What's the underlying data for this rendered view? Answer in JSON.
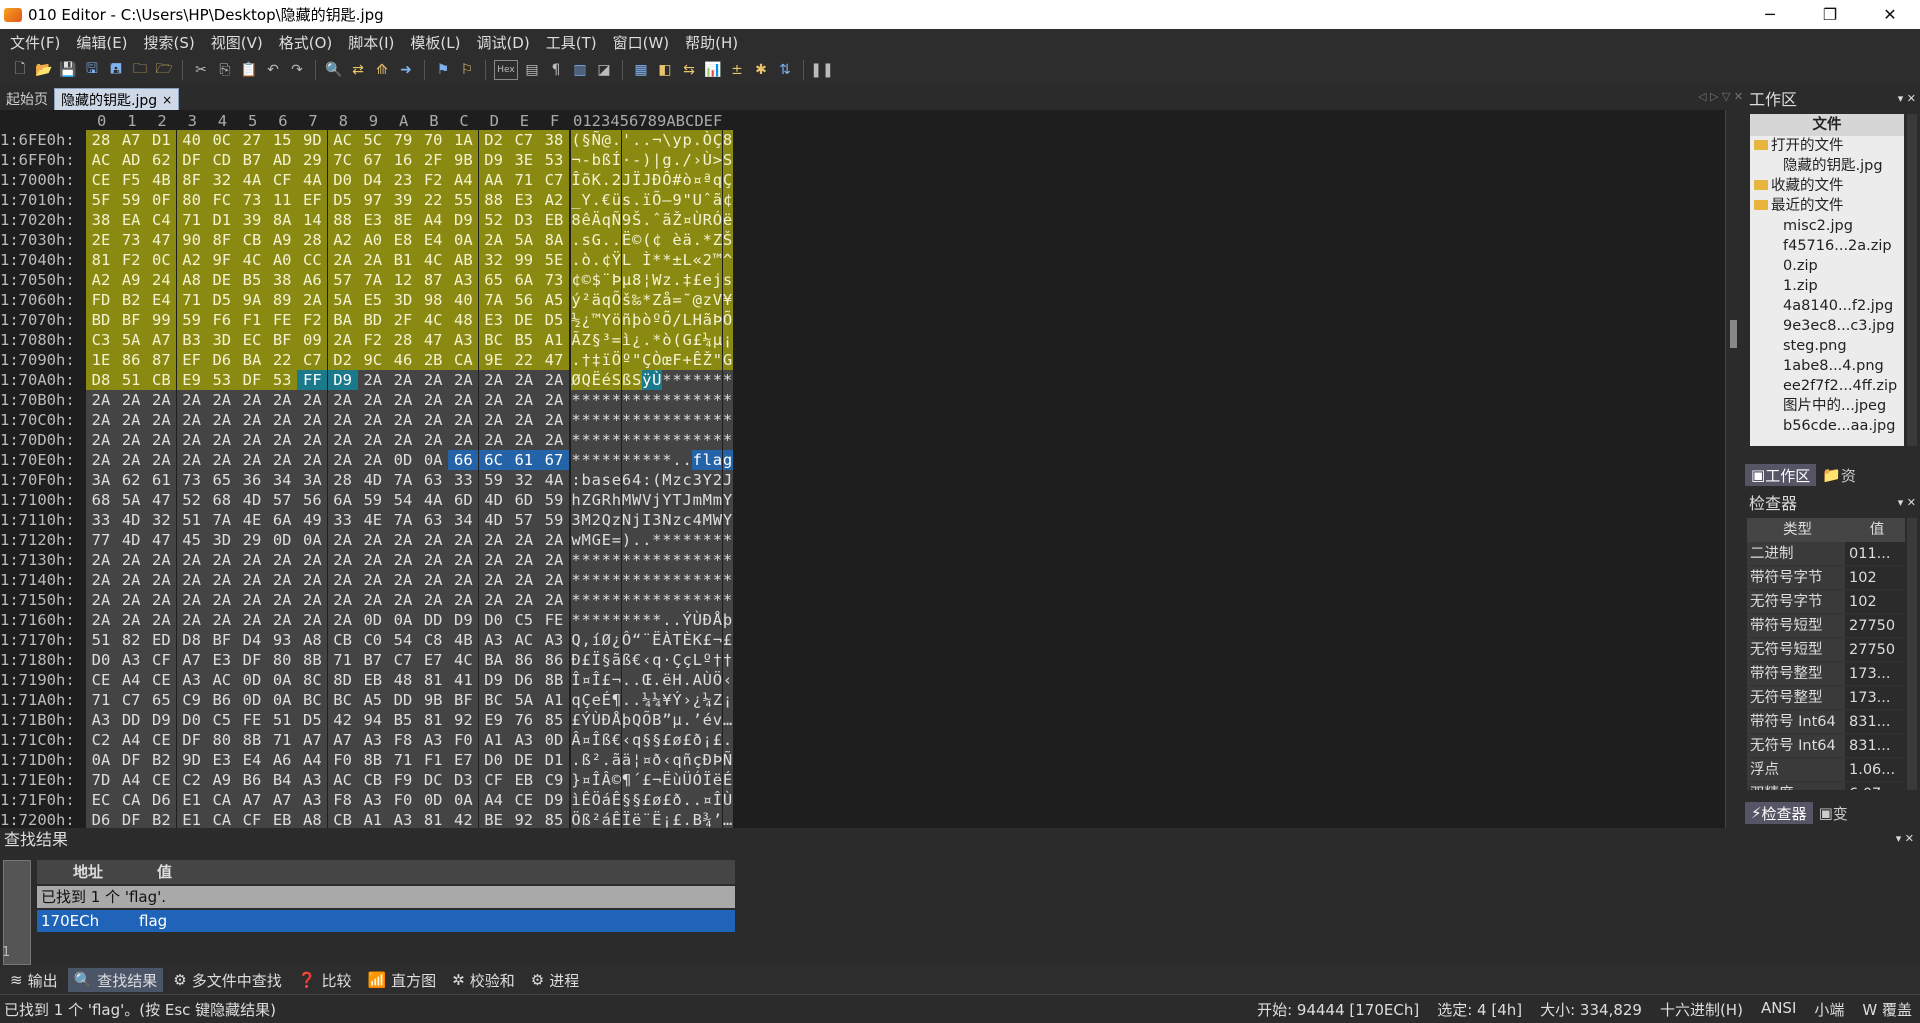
{
  "window": {
    "title": "010 Editor - C:\\Users\\HP\\Desktop\\隐藏的钥匙.jpg",
    "minimize": "─",
    "restore": "❐",
    "close": "✕"
  },
  "menu": [
    "文件(F)",
    "编辑(E)",
    "搜索(S)",
    "视图(V)",
    "格式(O)",
    "脚本(I)",
    "模板(L)",
    "调试(D)",
    "工具(T)",
    "窗口(W)",
    "帮助(H)"
  ],
  "toolbar": {
    "hex_label": "Hex"
  },
  "tabs": [
    {
      "label": "起始页"
    },
    {
      "label": "隐藏的钥匙.jpg",
      "close": "×"
    }
  ],
  "hex": {
    "col_headers": [
      "0",
      "1",
      "2",
      "3",
      "4",
      "5",
      "6",
      "7",
      "8",
      "9",
      "A",
      "B",
      "C",
      "D",
      "E",
      "F"
    ],
    "ascii_header": "0123456789ABCDEF",
    "rows": [
      {
        "addr": "1:6FE0h:",
        "bytes": "28 A7 D1 40 0C 27 15 9D AC 5C 79 70 1A D2 C7 38",
        "ascii": "(§Ñ@.'..¬\\yp.ÒÇ8",
        "hl": "yyyyyyyyyyyyyyyy"
      },
      {
        "addr": "1:6FF0h:",
        "bytes": "AC AD 62 DF CD B7 AD 29 7C 67 16 2F 9B D9 3E 53",
        "ascii": "¬-bßÍ·-)|g./›Ù>S",
        "hl": "yyyyyyyyyyyyyyyy"
      },
      {
        "addr": "1:7000h:",
        "bytes": "CE F5 4B 8F 32 4A CF 4A D0 D4 23 F2 A4 AA 71 C7",
        "ascii": "ÎõK.2JÏJÐÔ#ò¤ªqÇ",
        "hl": "yyyyyyyyyyyyyyyy"
      },
      {
        "addr": "1:7010h:",
        "bytes": "5F 59 0F 80 FC 73 11 EF D5 97 39 22 55 88 E3 A2",
        "ascii": "_Y.€üs.ïÕ—9\"Uˆã¢",
        "hl": "yyyyyyyyyyyyyyyy"
      },
      {
        "addr": "1:7020h:",
        "bytes": "38 EA C4 71 D1 39 8A 14 88 E3 8E A4 D9 52 D3 EB",
        "ascii": "8êÄqÑ9Š.ˆãŽ¤ÙRÓë",
        "hl": "yyyyyyyyyyyyyyyy"
      },
      {
        "addr": "1:7030h:",
        "bytes": "2E 73 47 90 8F CB A9 28 A2 A0 E8 E4 0A 2A 5A 8A",
        "ascii": ".sG..Ë©(¢ èä.*ZŠ",
        "hl": "yyyyyyyyyyyyyyyy"
      },
      {
        "addr": "1:7040h:",
        "bytes": "81 F2 0C A2 9F 4C A0 CC 2A 2A B1 4C AB 32 99 5E",
        "ascii": ".ò.¢ŸL Ì**±L«2™^",
        "hl": "yyyyyyyyyyyyyyyy"
      },
      {
        "addr": "1:7050h:",
        "bytes": "A2 A9 24 A8 DE B5 38 A6 57 7A 12 87 A3 65 6A 73",
        "ascii": "¢©$¨Þµ8¦Wz.‡£ejs",
        "hl": "yyyyyyyyyyyyyyyy"
      },
      {
        "addr": "1:7060h:",
        "bytes": "FD B2 E4 71 D5 9A 89 2A 5A E5 3D 98 40 7A 56 A5",
        "ascii": "ý²äqÕš‰*Zå=˜@zV¥",
        "hl": "yyyyyyyyyyyyyyyy"
      },
      {
        "addr": "1:7070h:",
        "bytes": "BD BF 99 59 F6 F1 FE F2 BA BD 2F 4C 48 E3 DE D5",
        "ascii": "½¿™YöñþòºÕ/LHãÞÕ",
        "hl": "yyyyyyyyyyyyyyyy"
      },
      {
        "addr": "1:7080h:",
        "bytes": "C3 5A A7 B3 3D EC BF 09 2A F2 28 47 A3 BC B5 A1",
        "ascii": "ÃZ§³=ì¿.*ò(G£¼µ¡",
        "hl": "yyyyyyyyyyyyyyyy"
      },
      {
        "addr": "1:7090h:",
        "bytes": "1E 86 87 EF D6 BA 22 C7 D2 9C 46 2B CA 9E 22 47",
        "ascii": ".†‡ïÖº\"ÇÒœF+ÊŽ\"G",
        "hl": "yyyyyyyyyyyyyyyy"
      },
      {
        "addr": "1:70A0h:",
        "bytes": "D8 51 CB E9 53 DF 53 FF D9 2A 2A 2A 2A 2A 2A 2A",
        "ascii": "ØQËéSßSÿÙ*******",
        "hl": "yyyyyyyttggggggg"
      },
      {
        "addr": "1:70B0h:",
        "bytes": "2A 2A 2A 2A 2A 2A 2A 2A 2A 2A 2A 2A 2A 2A 2A 2A",
        "ascii": "****************",
        "hl": "gggggggggggggggg"
      },
      {
        "addr": "1:70C0h:",
        "bytes": "2A 2A 2A 2A 2A 2A 2A 2A 2A 2A 2A 2A 2A 2A 2A 2A",
        "ascii": "****************",
        "hl": "gggggggggggggggg"
      },
      {
        "addr": "1:70D0h:",
        "bytes": "2A 2A 2A 2A 2A 2A 2A 2A 2A 2A 2A 2A 2A 2A 2A 2A",
        "ascii": "****************",
        "hl": "gggggggggggggggg"
      },
      {
        "addr": "1:70E0h:",
        "bytes": "2A 2A 2A 2A 2A 2A 2A 2A 2A 2A 0D 0A 66 6C 61 67",
        "ascii": "**********..flag",
        "hl": "ggggggggggggbbbb"
      },
      {
        "addr": "1:70F0h:",
        "bytes": "3A 62 61 73 65 36 34 3A 28 4D 7A 63 33 59 32 4A",
        "ascii": ":base64:(Mzc3Y2J",
        "hl": "gggggggggggggggg"
      },
      {
        "addr": "1:7100h:",
        "bytes": "68 5A 47 52 68 4D 57 56 6A 59 54 4A 6D 4D 6D 59",
        "ascii": "hZGRhMWVjYTJmMmY",
        "hl": "gggggggggggggggg"
      },
      {
        "addr": "1:7110h:",
        "bytes": "33 4D 32 51 7A 4E 6A 49 33 4E 7A 63 34 4D 57 59",
        "ascii": "3M2QzNjI3Nzc4MWY",
        "hl": "gggggggggggggggg"
      },
      {
        "addr": "1:7120h:",
        "bytes": "77 4D 47 45 3D 29 0D 0A 2A 2A 2A 2A 2A 2A 2A 2A",
        "ascii": "wMGE=)..********",
        "hl": "gggggggggggggggg"
      },
      {
        "addr": "1:7130h:",
        "bytes": "2A 2A 2A 2A 2A 2A 2A 2A 2A 2A 2A 2A 2A 2A 2A 2A",
        "ascii": "****************",
        "hl": "gggggggggggggggg"
      },
      {
        "addr": "1:7140h:",
        "bytes": "2A 2A 2A 2A 2A 2A 2A 2A 2A 2A 2A 2A 2A 2A 2A 2A",
        "ascii": "****************",
        "hl": "gggggggggggggggg"
      },
      {
        "addr": "1:7150h:",
        "bytes": "2A 2A 2A 2A 2A 2A 2A 2A 2A 2A 2A 2A 2A 2A 2A 2A",
        "ascii": "****************",
        "hl": "gggggggggggggggg"
      },
      {
        "addr": "1:7160h:",
        "bytes": "2A 2A 2A 2A 2A 2A 2A 2A 2A 0D 0A DD D9 D0 C5 FE",
        "ascii": "*********..ÝÙÐÅþ",
        "hl": "gggggggggggggggg"
      },
      {
        "addr": "1:7170h:",
        "bytes": "51 82 ED D8 BF D4 93 A8 CB C0 54 C8 4B A3 AC A3",
        "ascii": "Q‚íØ¿Ô“¨ËÀTÈK£¬£",
        "hl": "gggggggggggggggg"
      },
      {
        "addr": "1:7180h:",
        "bytes": "D0 A3 CF A7 E3 DF 80 8B 71 B7 C7 E7 4C BA 86 86",
        "ascii": "Ð£Ï§ãß€‹q·ÇçLº††",
        "hl": "gggggggggggggggg"
      },
      {
        "addr": "1:7190h:",
        "bytes": "CE A4 CE A3 AC 0D 0A 8C 8D EB 48 81 41 D9 D6 8B",
        "ascii": "Î¤Î£¬..Œ.ëH.AÙÖ‹",
        "hl": "gggggggggggggggg"
      },
      {
        "addr": "1:71A0h:",
        "bytes": "71 C7 65 C9 B6 0D 0A BC BC A5 DD 9B BF BC 5A A1",
        "ascii": "qÇeÉ¶..¼¼¥Ý›¿¼Z¡",
        "hl": "gggggggggggggggg"
      },
      {
        "addr": "1:71B0h:",
        "bytes": "A3 DD D9 D0 C5 FE 51 D5 42 94 B5 81 92 E9 76 85",
        "ascii": "£ÝÙÐÅþQÕB”µ.’év…",
        "hl": "gggggggggggggggg"
      },
      {
        "addr": "1:71C0h:",
        "bytes": "C2 A4 CE DF 80 8B 71 A7 A7 A3 F8 A3 F0 A1 A3 0D",
        "ascii": "Â¤Îß€‹q§§£ø£ð¡£.",
        "hl": "gggggggggggggggg"
      },
      {
        "addr": "1:71D0h:",
        "bytes": "0A DF B2 9D E3 E4 A6 A4 F0 8B 71 F1 E7 D0 DE D1",
        "ascii": ".ß².ãä¦¤ð‹qñçÐÞÑ",
        "hl": "gggggggggggggggg"
      },
      {
        "addr": "1:71E0h:",
        "bytes": "7D A4 CE C2 A9 B6 B4 A3 AC CB F9 DC D3 CF EB C9",
        "ascii": "}¤ÎÂ©¶´£¬ËùÜÓÏëÉ",
        "hl": "gggggggggggggggg"
      },
      {
        "addr": "1:71F0h:",
        "bytes": "EC CA D6 E1 CA A7 A7 A3 F8 A3 F0 0D 0A A4 CE D9",
        "ascii": "ìÊÖáÊ§§£ø£ð..¤ÎÙ",
        "hl": "gggggggggggggggg"
      },
      {
        "addr": "1:7200h:",
        "bytes": "D6 DF B2 E1 CA CF EB A8 CB A1 A3 81 42 BE 92 85",
        "ascii": "Öß²áÊÏë¨Ë¡£.B¾’…",
        "hl": "gggggggggggggggg"
      }
    ]
  },
  "workspace": {
    "title": "工作区",
    "header": "文件",
    "open_files_label": "打开的文件",
    "open_files": [
      "隐藏的钥匙.jpg"
    ],
    "favorites_label": "收藏的文件",
    "recent_label": "最近的文件",
    "recent": [
      "misc2.jpg",
      "f45716...2a.zip",
      "0.zip",
      "1.zip",
      "4a8140...f2.jpg",
      "9e3ec8...c3.jpg",
      "steg.png",
      "1abe8...4.png",
      "ee2f7f2...4ff.zip",
      "图片中的...jpeg",
      "b56cde...aa.jpg"
    ],
    "tab_workspace": "工作区",
    "tab_resources": "资"
  },
  "inspector": {
    "title": "检查器",
    "col_type": "类型",
    "col_value": "值",
    "rows": [
      {
        "type": "二进制",
        "value": "011..."
      },
      {
        "type": "带符号字节",
        "value": "102"
      },
      {
        "type": "无符号字节",
        "value": "102"
      },
      {
        "type": "带符号短型",
        "value": "27750"
      },
      {
        "type": "无符号短型",
        "value": "27750"
      },
      {
        "type": "带符号整型",
        "value": "173..."
      },
      {
        "type": "无符号整型",
        "value": "173..."
      },
      {
        "type": "带符号 Int64",
        "value": "831..."
      },
      {
        "type": "无符号 Int64",
        "value": "831..."
      },
      {
        "type": "浮点",
        "value": "1.06..."
      },
      {
        "type": "双精度",
        "value": "6.07..."
      }
    ],
    "tab_inspector": "检查器",
    "tab_variables": "变"
  },
  "find": {
    "title": "查找结果",
    "col_address": "地址",
    "col_value": "值",
    "summary": "已找到 1 个 'flag'.",
    "results": [
      {
        "address": "170ECh",
        "value": "flag"
      }
    ],
    "line_no": "1"
  },
  "bottom_tabs": [
    "输出",
    "查找结果",
    "多文件中查找",
    "比较",
    "直方图",
    "校验和",
    "进程"
  ],
  "status": {
    "message": "已找到 1 个 'flag'。(按 Esc 键隐藏结果)",
    "start": "开始: 94444 [170ECh]",
    "selected": "选定: 4 [4h]",
    "size": "大小: 334,829",
    "mode": "十六进制(H)",
    "encoding": "ANSI",
    "endian": "小端",
    "overwrite": "W  覆盖"
  }
}
